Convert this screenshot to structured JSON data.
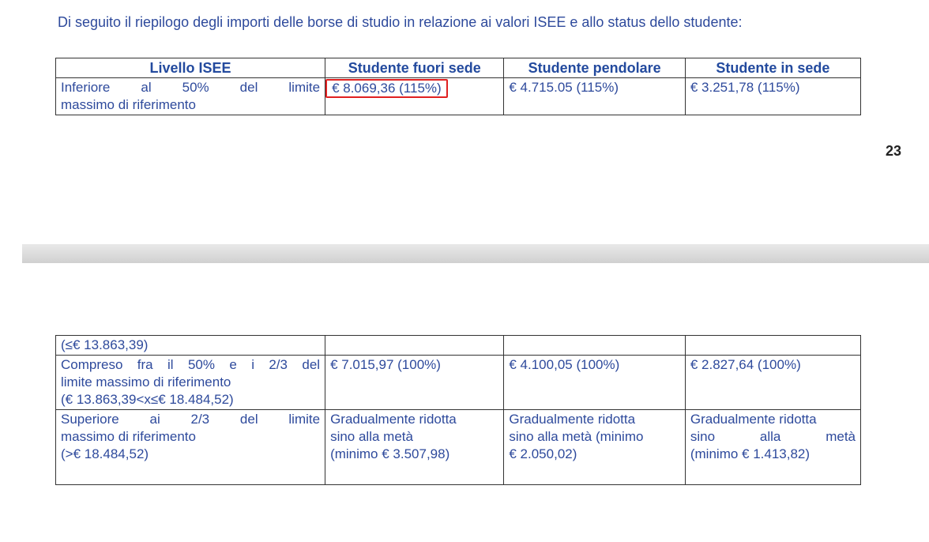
{
  "intro": "Di seguito il riepilogo degli importi delle borse di studio in relazione ai valori ISEE e allo status dello studente:",
  "headers": [
    "Livello ISEE",
    "Studente fuori sede",
    "Studente pendolare",
    "Studente in sede"
  ],
  "page1": {
    "row1": {
      "level_line1": "Inferiore al 50% del limite",
      "level_line2": "massimo di riferimento",
      "fuori_sede": "€ 8.069,36 (115%)",
      "pendolare": "€ 4.715.05 (115%)",
      "in_sede": "€ 3.251,78 (115%)"
    }
  },
  "page_number": "23",
  "page2": {
    "cont_row": {
      "level": "(≤€ 13.863,39)"
    },
    "row2": {
      "level_line1": "Compreso fra il 50% e i 2/3 del",
      "level_line2": "limite massimo di riferimento",
      "level_line3": "(€ 13.863,39<x≤€ 18.484,52)",
      "fuori_sede": "€ 7.015,97 (100%)",
      "pendolare": "€ 4.100,05 (100%)",
      "in_sede": "€ 2.827,64 (100%)"
    },
    "row3": {
      "level_line1": "Superiore ai 2/3 del limite",
      "level_line2": "massimo di riferimento",
      "level_line3": "(>€ 18.484,52)",
      "fuori_sede_line1": "Gradualmente ridotta",
      "fuori_sede_line2": "sino alla metà",
      "fuori_sede_line3": "(minimo € 3.507,98)",
      "pendolare_line1": "Gradualmente ridotta",
      "pendolare_line2": "sino alla metà (minimo",
      "pendolare_line3": "€ 2.050,02)",
      "in_sede_line1": "Gradualmente ridotta",
      "in_sede_line2": "sino alla metà",
      "in_sede_line3": "(minimo € 1.413,82)"
    }
  },
  "colors": {
    "text": "#2e4a9c",
    "highlight": "#e02020"
  }
}
